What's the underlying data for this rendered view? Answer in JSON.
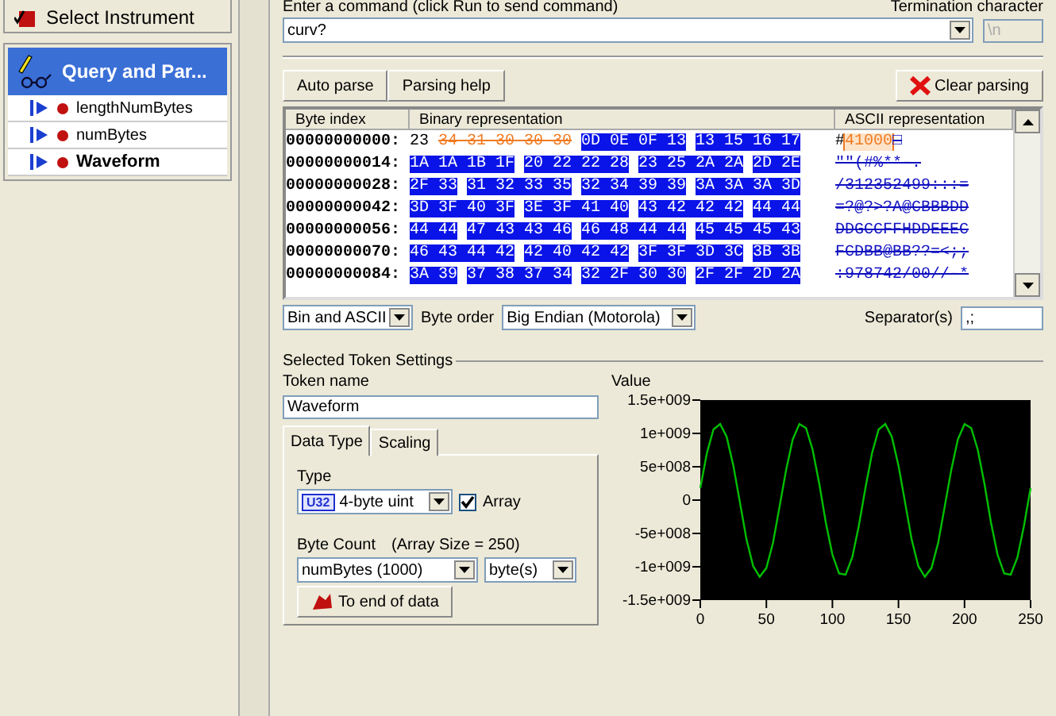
{
  "sidebar": {
    "select_instrument": "Select Instrument",
    "section_title": "Query and Par...",
    "items": [
      {
        "label": "lengthNumBytes",
        "selected": false
      },
      {
        "label": "numBytes",
        "selected": false
      },
      {
        "label": "Waveform",
        "selected": true
      }
    ]
  },
  "command": {
    "label": "Enter a command (click Run to send command)",
    "value": "curv?",
    "termination_label": "Termination character",
    "termination_value": "\\n",
    "termination_disabled": true
  },
  "buttons": {
    "auto_parse": "Auto parse",
    "parsing_help": "Parsing help",
    "clear_parsing": "Clear parsing"
  },
  "table": {
    "columns": [
      "Byte index",
      "Binary representation",
      "ASCII representation"
    ],
    "rows": [
      {
        "index": "00000000000:",
        "hex": [
          {
            "text": "23",
            "kind": "plain"
          },
          {
            "text": "34 31 30 30 30",
            "kind": "length"
          },
          {
            "text": "0D 0E 0F 13",
            "kind": "data"
          },
          {
            "text": "13 15 16 17",
            "kind": "data"
          }
        ],
        "ascii": [
          {
            "text": "#",
            "kind": "plain"
          },
          {
            "text": "41000",
            "kind": "length"
          },
          {
            "text": "□",
            "kind": "data"
          }
        ]
      },
      {
        "index": "00000000014:",
        "hex": [
          {
            "text": "1A 1A 1B 1F",
            "kind": "data"
          },
          {
            "text": "20 22 22 28",
            "kind": "data"
          },
          {
            "text": "23 25 2A 2A",
            "kind": "data"
          },
          {
            "text": "2D 2E",
            "kind": "data"
          }
        ],
        "ascii": [
          {
            "text": "\"\"(#%**-.",
            "kind": "data"
          }
        ]
      },
      {
        "index": "00000000028:",
        "hex": [
          {
            "text": "2F 33",
            "kind": "data"
          },
          {
            "text": "31 32 33 35",
            "kind": "data"
          },
          {
            "text": "32 34 39 39",
            "kind": "data"
          },
          {
            "text": "3A 3A 3A 3D",
            "kind": "data"
          }
        ],
        "ascii": [
          {
            "text": "/312352499:::=",
            "kind": "data"
          }
        ]
      },
      {
        "index": "00000000042:",
        "hex": [
          {
            "text": "3D 3F 40 3F",
            "kind": "data"
          },
          {
            "text": "3E 3F 41 40",
            "kind": "data"
          },
          {
            "text": "43 42 42 42",
            "kind": "data"
          },
          {
            "text": "44 44",
            "kind": "data"
          }
        ],
        "ascii": [
          {
            "text": "=?@?>?A@CBBBDD",
            "kind": "data"
          }
        ]
      },
      {
        "index": "00000000056:",
        "hex": [
          {
            "text": "44 44",
            "kind": "data"
          },
          {
            "text": "47 43 43 46",
            "kind": "data"
          },
          {
            "text": "46 48 44 44",
            "kind": "data"
          },
          {
            "text": "45 45 45 43",
            "kind": "data"
          }
        ],
        "ascii": [
          {
            "text": "DDGCCFFHDDEEEC",
            "kind": "data"
          }
        ]
      },
      {
        "index": "00000000070:",
        "hex": [
          {
            "text": "46 43 44 42",
            "kind": "data"
          },
          {
            "text": "42 40 42 42",
            "kind": "data"
          },
          {
            "text": "3F 3F 3D 3C",
            "kind": "data"
          },
          {
            "text": "3B 3B",
            "kind": "data"
          }
        ],
        "ascii": [
          {
            "text": "FCDBB@BB??=<;;",
            "kind": "data"
          }
        ]
      },
      {
        "index": "00000000084:",
        "hex": [
          {
            "text": "3A 39",
            "kind": "data"
          },
          {
            "text": "37 38 37 34",
            "kind": "data"
          },
          {
            "text": "32 2F 30 30",
            "kind": "data"
          },
          {
            "text": "2F 2F 2D 2A",
            "kind": "data"
          }
        ],
        "ascii": [
          {
            "text": ":978742/00//-*",
            "kind": "data"
          }
        ]
      }
    ]
  },
  "options": {
    "view": "Bin and ASCII",
    "byte_order_label": "Byte order",
    "byte_order": "Big Endian (Motorola)",
    "separator_label": "Separator(s)",
    "separator": ",;"
  },
  "token": {
    "group_title": "Selected Token Settings",
    "name_label": "Token name",
    "name": "Waveform",
    "tabs": [
      {
        "label": "Data Type",
        "selected": true
      },
      {
        "label": "Scaling",
        "selected": false
      }
    ],
    "type_label": "Type",
    "type_badge": "U32",
    "type": "4-byte uint",
    "array_label": "Array",
    "array_checked": true,
    "byte_count_label": "Byte Count",
    "array_size": "(Array Size = 250)",
    "byte_count": "numBytes (1000)",
    "unit": "byte(s)",
    "end_button": "To end of data"
  },
  "value_chart": {
    "label": "Value",
    "chart_data": {
      "type": "line",
      "xlim": [
        0,
        250
      ],
      "ylim": [
        -1500000000.0,
        1500000000.0
      ],
      "xticks": [
        0,
        50,
        100,
        150,
        200,
        250
      ],
      "yticks": [
        {
          "value": 1500000000.0,
          "label": "1.5e+009"
        },
        {
          "value": 1000000000.0,
          "label": "1e+009"
        },
        {
          "value": 500000000.0,
          "label": "5e+008"
        },
        {
          "value": 0,
          "label": "0"
        },
        {
          "value": -500000000.0,
          "label": "-5e+008"
        },
        {
          "value": -1000000000.0,
          "label": "-1e+009"
        },
        {
          "value": -1500000000.0,
          "label": "-1.5e+009"
        }
      ],
      "x": [
        0,
        5,
        10,
        15,
        20,
        25,
        30,
        35,
        40,
        45,
        50,
        55,
        60,
        65,
        70,
        75,
        80,
        85,
        90,
        95,
        100,
        105,
        110,
        115,
        120,
        125,
        130,
        135,
        140,
        145,
        150,
        155,
        160,
        165,
        170,
        175,
        180,
        185,
        190,
        195,
        200,
        205,
        210,
        215,
        220,
        225,
        230,
        235,
        240,
        245,
        250
      ],
      "series": [
        {
          "color": "#00c000",
          "values": [
            180000000.0,
            710000000.0,
            1060000000.0,
            1140000000.0,
            950000000.0,
            520000000.0,
            -40000000.0,
            -590000000.0,
            -990000000.0,
            -1150000000.0,
            -1020000000.0,
            -640000000.0,
            -100000000.0,
            460000000.0,
            910000000.0,
            1140000000.0,
            1080000000.0,
            760000000.0,
            250000000.0,
            -330000000.0,
            -820000000.0,
            -1100000000.0,
            -1120000000.0,
            -860000000.0,
            -390000000.0,
            180000000.0,
            710000000.0,
            1060000000.0,
            1140000000.0,
            950000000.0,
            520000000.0,
            -40000000.0,
            -590000000.0,
            -990000000.0,
            -1150000000.0,
            -1020000000.0,
            -640000000.0,
            -100000000.0,
            460000000.0,
            910000000.0,
            1140000000.0,
            1080000000.0,
            760000000.0,
            250000000.0,
            -330000000.0,
            -820000000.0,
            -1100000000.0,
            -1120000000.0,
            -860000000.0,
            -390000000.0,
            180000000.0
          ]
        }
      ]
    }
  }
}
